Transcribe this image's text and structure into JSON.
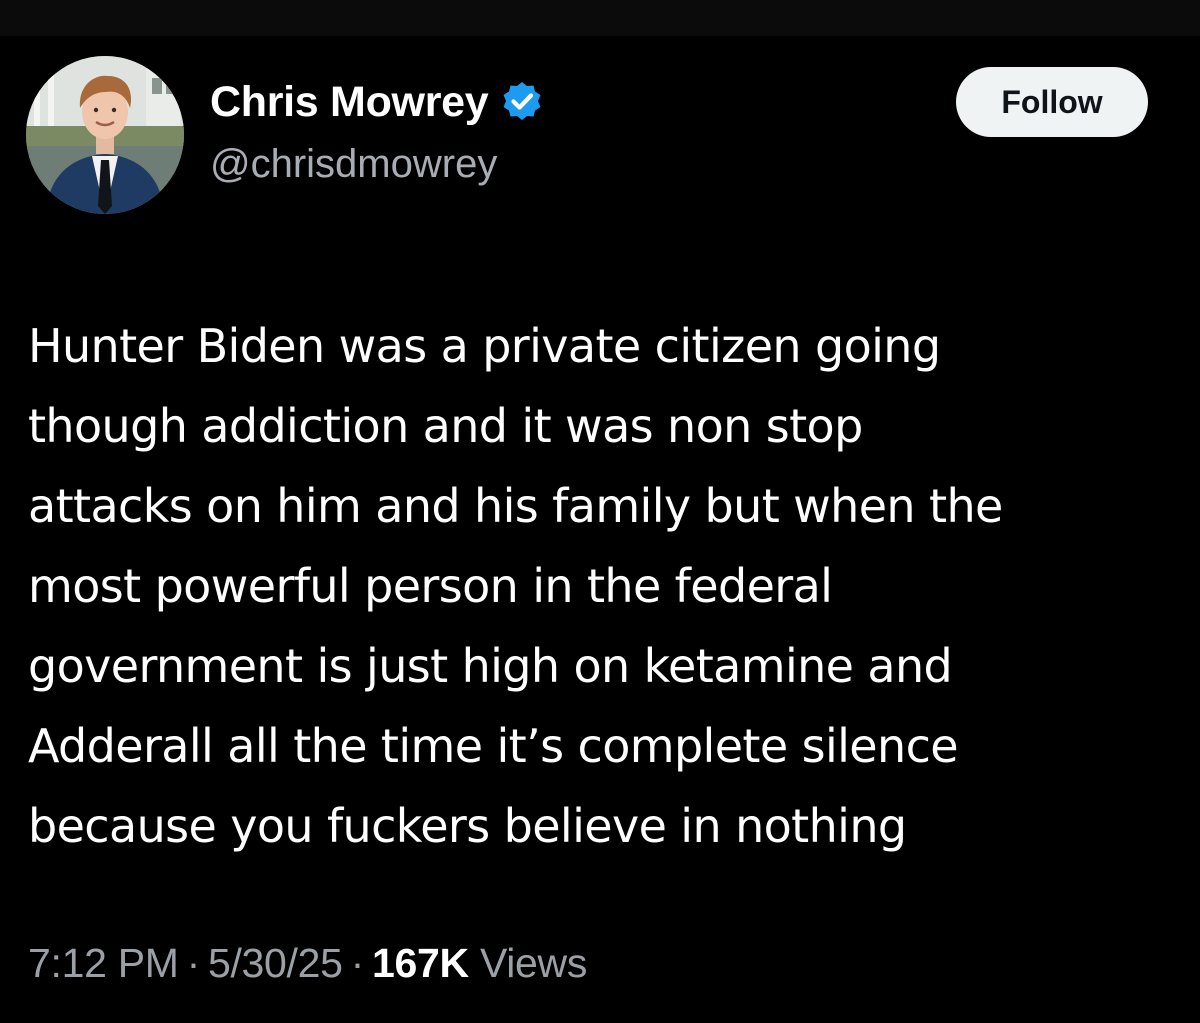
{
  "author": {
    "display_name": "Chris Mowrey",
    "handle": "@chrisdmowrey",
    "verified": true
  },
  "actions": {
    "follow_label": "Follow"
  },
  "tweet": {
    "text_lines": [
      "Hunter Biden was a private citizen going",
      "though addiction and it was non stop",
      "attacks on him and his family but when the",
      "most powerful person in the federal",
      "government is just high on ketamine and",
      "Adderall all the time it’s complete silence",
      "because you fuckers believe in nothing"
    ]
  },
  "meta": {
    "time": "7:12 PM",
    "separator": "·",
    "date": "5/30/25",
    "views_count": "167K",
    "views_label": "Views"
  },
  "colors": {
    "background": "#000000",
    "verified_badge": "#1d9bf0",
    "secondary_text": "#9aa0a6",
    "follow_button_bg": "#eff3f4"
  }
}
